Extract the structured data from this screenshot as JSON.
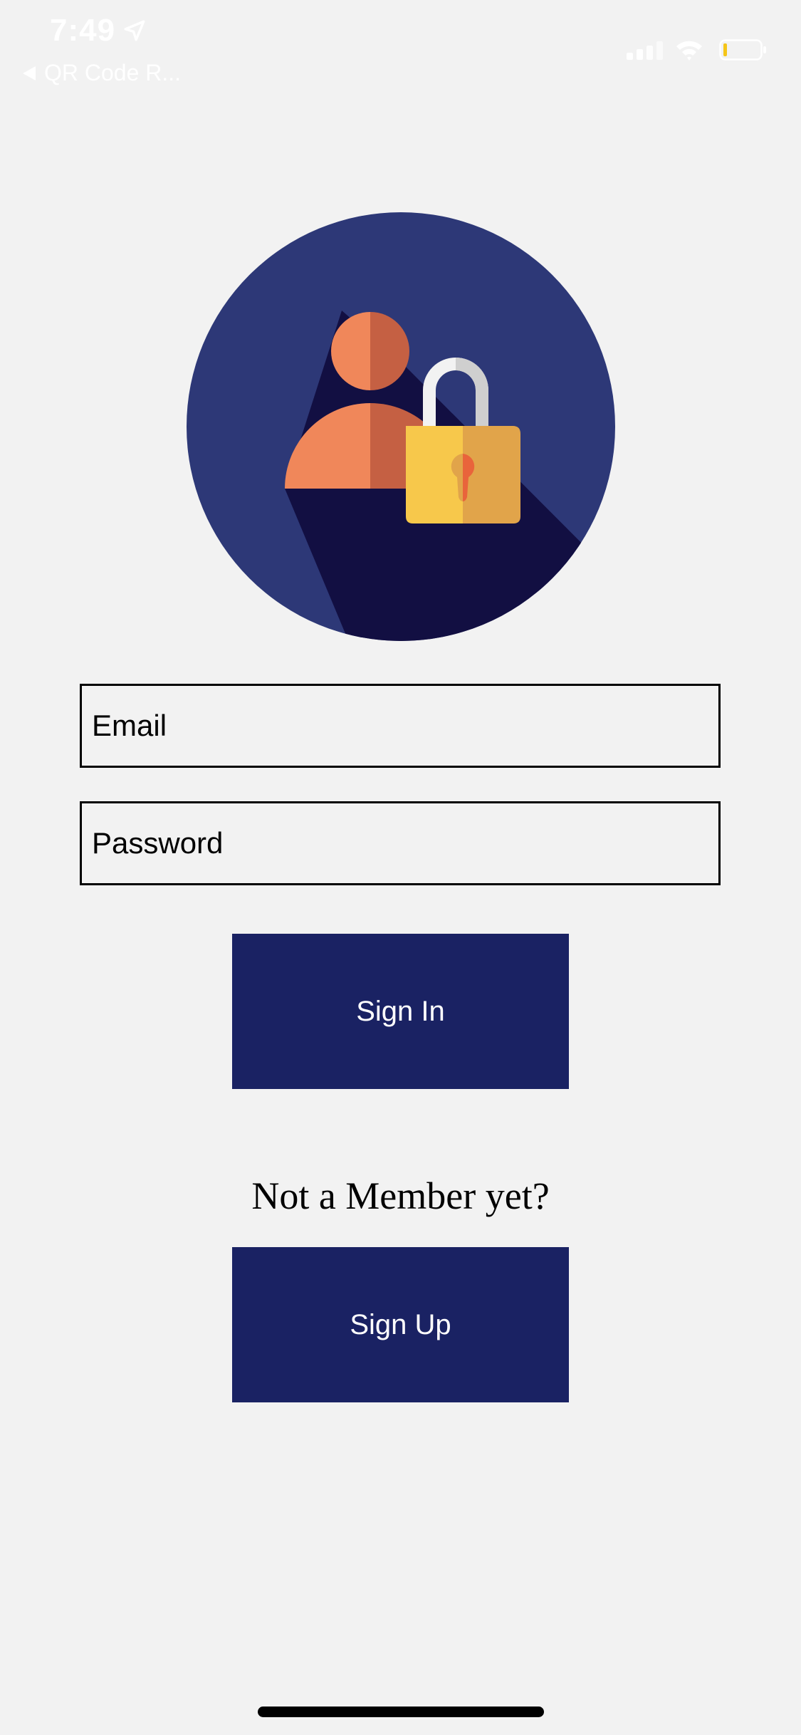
{
  "status_bar": {
    "time": "7:49",
    "back_label": "QR Code R...",
    "icons": [
      "location-arrow-icon",
      "back-caret-icon",
      "cellular-signal-icon",
      "wifi-icon",
      "battery-icon"
    ]
  },
  "hero": {
    "icon": "user-lock-icon",
    "colors": {
      "circle": "#2d3877",
      "shadow": "#120f42",
      "person_light": "#f0875a",
      "person_dark": "#c56043",
      "lock_light": "#f7c84b",
      "lock_dark": "#e1a44a",
      "shackle": "#d9d9d9",
      "keyhole": "#e9643b"
    }
  },
  "form": {
    "email_placeholder": "Email",
    "password_placeholder": "Password",
    "sign_in_label": "Sign In",
    "member_prompt": "Not a Member yet?",
    "sign_up_label": "Sign Up"
  },
  "theme": {
    "background": "#f2f2f2",
    "button": "#1a2263",
    "button_text": "#ffffff",
    "field_border": "#000000"
  }
}
